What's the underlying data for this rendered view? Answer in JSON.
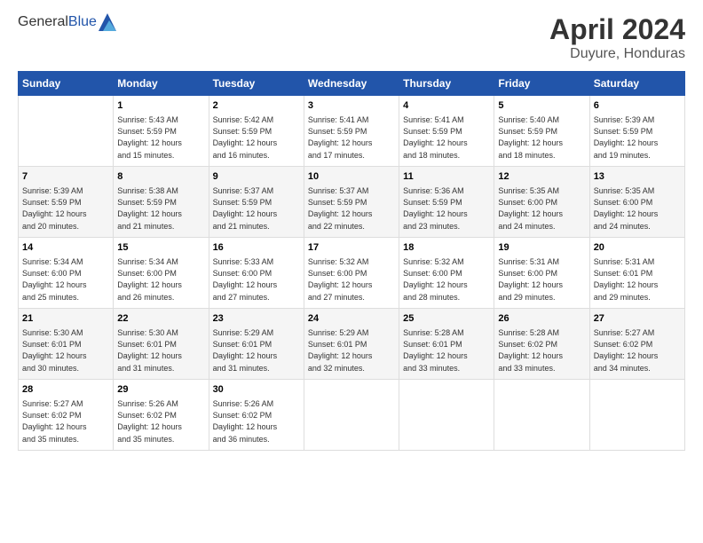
{
  "header": {
    "logo_general": "General",
    "logo_blue": "Blue",
    "month": "April 2024",
    "location": "Duyure, Honduras"
  },
  "weekdays": [
    "Sunday",
    "Monday",
    "Tuesday",
    "Wednesday",
    "Thursday",
    "Friday",
    "Saturday"
  ],
  "weeks": [
    [
      {
        "day": "",
        "info": ""
      },
      {
        "day": "1",
        "info": "Sunrise: 5:43 AM\nSunset: 5:59 PM\nDaylight: 12 hours\nand 15 minutes."
      },
      {
        "day": "2",
        "info": "Sunrise: 5:42 AM\nSunset: 5:59 PM\nDaylight: 12 hours\nand 16 minutes."
      },
      {
        "day": "3",
        "info": "Sunrise: 5:41 AM\nSunset: 5:59 PM\nDaylight: 12 hours\nand 17 minutes."
      },
      {
        "day": "4",
        "info": "Sunrise: 5:41 AM\nSunset: 5:59 PM\nDaylight: 12 hours\nand 18 minutes."
      },
      {
        "day": "5",
        "info": "Sunrise: 5:40 AM\nSunset: 5:59 PM\nDaylight: 12 hours\nand 18 minutes."
      },
      {
        "day": "6",
        "info": "Sunrise: 5:39 AM\nSunset: 5:59 PM\nDaylight: 12 hours\nand 19 minutes."
      }
    ],
    [
      {
        "day": "7",
        "info": "Sunrise: 5:39 AM\nSunset: 5:59 PM\nDaylight: 12 hours\nand 20 minutes."
      },
      {
        "day": "8",
        "info": "Sunrise: 5:38 AM\nSunset: 5:59 PM\nDaylight: 12 hours\nand 21 minutes."
      },
      {
        "day": "9",
        "info": "Sunrise: 5:37 AM\nSunset: 5:59 PM\nDaylight: 12 hours\nand 21 minutes."
      },
      {
        "day": "10",
        "info": "Sunrise: 5:37 AM\nSunset: 5:59 PM\nDaylight: 12 hours\nand 22 minutes."
      },
      {
        "day": "11",
        "info": "Sunrise: 5:36 AM\nSunset: 5:59 PM\nDaylight: 12 hours\nand 23 minutes."
      },
      {
        "day": "12",
        "info": "Sunrise: 5:35 AM\nSunset: 6:00 PM\nDaylight: 12 hours\nand 24 minutes."
      },
      {
        "day": "13",
        "info": "Sunrise: 5:35 AM\nSunset: 6:00 PM\nDaylight: 12 hours\nand 24 minutes."
      }
    ],
    [
      {
        "day": "14",
        "info": "Sunrise: 5:34 AM\nSunset: 6:00 PM\nDaylight: 12 hours\nand 25 minutes."
      },
      {
        "day": "15",
        "info": "Sunrise: 5:34 AM\nSunset: 6:00 PM\nDaylight: 12 hours\nand 26 minutes."
      },
      {
        "day": "16",
        "info": "Sunrise: 5:33 AM\nSunset: 6:00 PM\nDaylight: 12 hours\nand 27 minutes."
      },
      {
        "day": "17",
        "info": "Sunrise: 5:32 AM\nSunset: 6:00 PM\nDaylight: 12 hours\nand 27 minutes."
      },
      {
        "day": "18",
        "info": "Sunrise: 5:32 AM\nSunset: 6:00 PM\nDaylight: 12 hours\nand 28 minutes."
      },
      {
        "day": "19",
        "info": "Sunrise: 5:31 AM\nSunset: 6:00 PM\nDaylight: 12 hours\nand 29 minutes."
      },
      {
        "day": "20",
        "info": "Sunrise: 5:31 AM\nSunset: 6:01 PM\nDaylight: 12 hours\nand 29 minutes."
      }
    ],
    [
      {
        "day": "21",
        "info": "Sunrise: 5:30 AM\nSunset: 6:01 PM\nDaylight: 12 hours\nand 30 minutes."
      },
      {
        "day": "22",
        "info": "Sunrise: 5:30 AM\nSunset: 6:01 PM\nDaylight: 12 hours\nand 31 minutes."
      },
      {
        "day": "23",
        "info": "Sunrise: 5:29 AM\nSunset: 6:01 PM\nDaylight: 12 hours\nand 31 minutes."
      },
      {
        "day": "24",
        "info": "Sunrise: 5:29 AM\nSunset: 6:01 PM\nDaylight: 12 hours\nand 32 minutes."
      },
      {
        "day": "25",
        "info": "Sunrise: 5:28 AM\nSunset: 6:01 PM\nDaylight: 12 hours\nand 33 minutes."
      },
      {
        "day": "26",
        "info": "Sunrise: 5:28 AM\nSunset: 6:02 PM\nDaylight: 12 hours\nand 33 minutes."
      },
      {
        "day": "27",
        "info": "Sunrise: 5:27 AM\nSunset: 6:02 PM\nDaylight: 12 hours\nand 34 minutes."
      }
    ],
    [
      {
        "day": "28",
        "info": "Sunrise: 5:27 AM\nSunset: 6:02 PM\nDaylight: 12 hours\nand 35 minutes."
      },
      {
        "day": "29",
        "info": "Sunrise: 5:26 AM\nSunset: 6:02 PM\nDaylight: 12 hours\nand 35 minutes."
      },
      {
        "day": "30",
        "info": "Sunrise: 5:26 AM\nSunset: 6:02 PM\nDaylight: 12 hours\nand 36 minutes."
      },
      {
        "day": "",
        "info": ""
      },
      {
        "day": "",
        "info": ""
      },
      {
        "day": "",
        "info": ""
      },
      {
        "day": "",
        "info": ""
      }
    ]
  ]
}
